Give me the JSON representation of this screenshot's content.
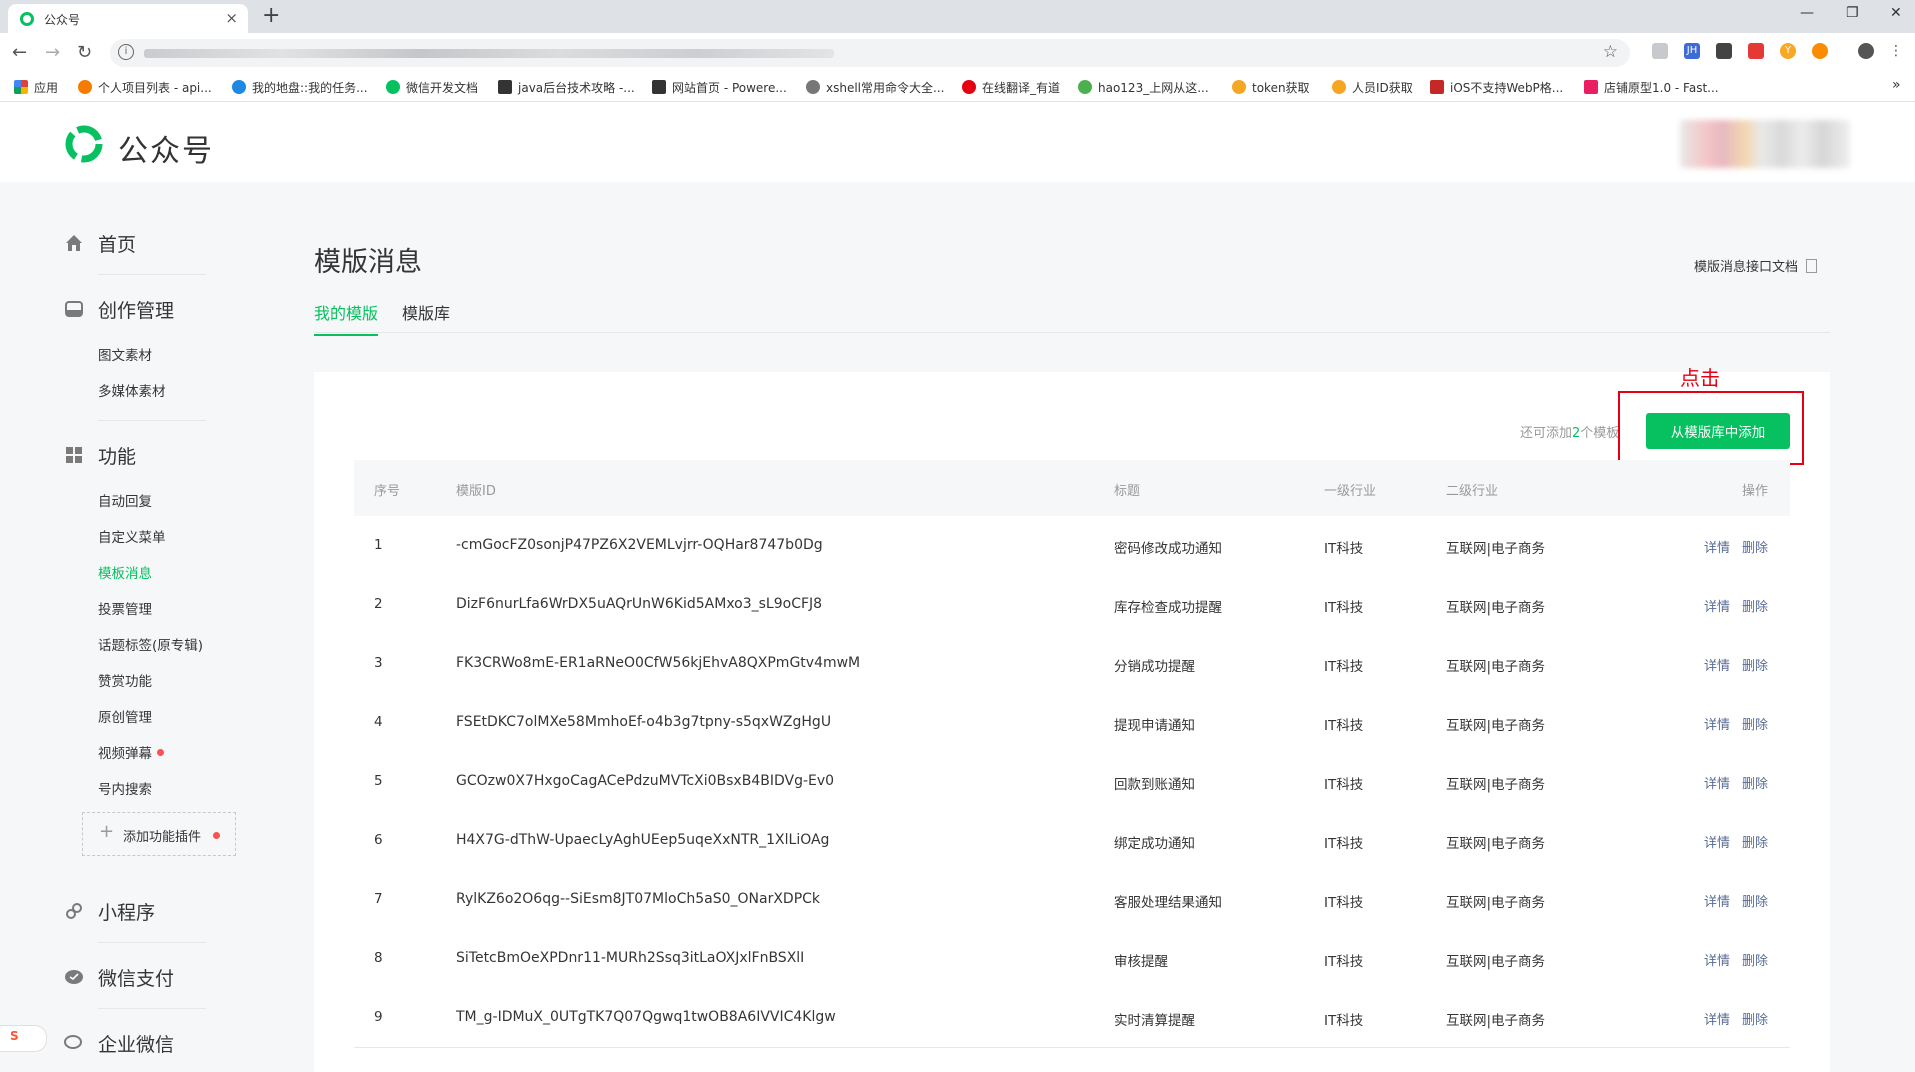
{
  "browser": {
    "tab_title": "公众号",
    "tab_close": "×",
    "new_tab": "+",
    "window_controls": [
      "—",
      "❐",
      "✕"
    ],
    "nav": {
      "back": "←",
      "forward": "→",
      "reload": "↻"
    },
    "star_icon": "☆",
    "bookmarks": [
      {
        "label": "应用",
        "color": "#db4437"
      },
      {
        "label": "个人项目列表 - api...",
        "color": "#f57c00"
      },
      {
        "label": "我的地盘::我的任务...",
        "color": "#1e88e5"
      },
      {
        "label": "微信开发文档",
        "color": "#07c160"
      },
      {
        "label": "java后台技术攻略 -...",
        "color": "#333333"
      },
      {
        "label": "网站首页 - Powere...",
        "color": "#333333"
      },
      {
        "label": "xshell常用命令大全...",
        "color": "#555555"
      },
      {
        "label": "在线翻译_有道",
        "color": "#e60012"
      },
      {
        "label": "hao123_上网从这...",
        "color": "#4caf50"
      },
      {
        "label": "token获取",
        "color": "#f5a623"
      },
      {
        "label": "人员ID获取",
        "color": "#f5a623"
      },
      {
        "label": "iOS不支持WebP格...",
        "color": "#c62828"
      },
      {
        "label": "店铺原型1.0 - Fast...",
        "color": "#e91e63"
      }
    ],
    "bookmarks_more": "»"
  },
  "header": {
    "brand": "公众号"
  },
  "sidebar": {
    "home": "首页",
    "creation": {
      "label": "创作管理",
      "items": [
        "图文素材",
        "多媒体素材"
      ]
    },
    "features": {
      "label": "功能",
      "items": [
        {
          "label": "自动回复",
          "active": false,
          "dot": false
        },
        {
          "label": "自定义菜单",
          "active": false,
          "dot": false
        },
        {
          "label": "模板消息",
          "active": true,
          "dot": false
        },
        {
          "label": "投票管理",
          "active": false,
          "dot": false
        },
        {
          "label": "话题标签(原专辑)",
          "active": false,
          "dot": false
        },
        {
          "label": "赞赏功能",
          "active": false,
          "dot": false
        },
        {
          "label": "原创管理",
          "active": false,
          "dot": false
        },
        {
          "label": "视频弹幕",
          "active": false,
          "dot": true
        },
        {
          "label": "号内搜索",
          "active": false,
          "dot": false
        }
      ],
      "add_plugin": "添加功能插件"
    },
    "mini_program": "小程序",
    "wechat_pay": "微信支付",
    "work_wechat": "企业微信"
  },
  "main": {
    "title": "模版消息",
    "api_doc": "模版消息接口文档",
    "tabs": [
      {
        "label": "我的模版",
        "active": true
      },
      {
        "label": "模版库",
        "active": false
      }
    ],
    "remaining_prefix": "还可添加",
    "remaining_count": "2",
    "remaining_suffix": "个模板",
    "add_button": "从模版库中添加",
    "annotation": "点击",
    "columns": [
      "序号",
      "模版ID",
      "标题",
      "一级行业",
      "二级行业",
      "操作"
    ],
    "rows": [
      {
        "no": "1",
        "id": "-cmGocFZ0sonjP47PZ6X2VEMLvjrr-OQHar8747b0Dg",
        "title": "密码修改成功通知",
        "industry1": "IT科技",
        "industry2": "互联网|电子商务"
      },
      {
        "no": "2",
        "id": "DizF6nurLfa6WrDX5uAQrUnW6Kid5AMxo3_sL9oCFJ8",
        "title": "库存检查成功提醒",
        "industry1": "IT科技",
        "industry2": "互联网|电子商务"
      },
      {
        "no": "3",
        "id": "FK3CRWo8mE-ER1aRNeO0CfW56kjEhvA8QXPmGtv4mwM",
        "title": "分销成功提醒",
        "industry1": "IT科技",
        "industry2": "互联网|电子商务"
      },
      {
        "no": "4",
        "id": "FSEtDKC7olMXe58MmhoEf-o4b3g7tpny-s5qxWZgHgU",
        "title": "提现申请通知",
        "industry1": "IT科技",
        "industry2": "互联网|电子商务"
      },
      {
        "no": "5",
        "id": "GCOzw0X7HxgoCagACePdzuMVTcXi0BsxB4BIDVg-Ev0",
        "title": "回款到账通知",
        "industry1": "IT科技",
        "industry2": "互联网|电子商务"
      },
      {
        "no": "6",
        "id": "H4X7G-dThW-UpaecLyAghUEep5uqeXxNTR_1XlLiOAg",
        "title": "绑定成功通知",
        "industry1": "IT科技",
        "industry2": "互联网|电子商务"
      },
      {
        "no": "7",
        "id": "RylKZ6o2O6qg--SiEsm8JT07MloCh5aS0_ONarXDPCk",
        "title": "客服处理结果通知",
        "industry1": "IT科技",
        "industry2": "互联网|电子商务"
      },
      {
        "no": "8",
        "id": "SiTetcBmOeXPDnr11-MURh2Ssq3itLaOXJxlFnBSXlI",
        "title": "审核提醒",
        "industry1": "IT科技",
        "industry2": "互联网|电子商务"
      },
      {
        "no": "9",
        "id": "TM_g-IDMuX_0UTgTK7Q07Qgwq1twOB8A6IVVIC4Klgw",
        "title": "实时清算提醒",
        "industry1": "IT科技",
        "industry2": "互联网|电子商务"
      }
    ],
    "ops": {
      "detail": "详情",
      "delete": "删除"
    }
  },
  "overlay": {
    "badge": "S"
  }
}
